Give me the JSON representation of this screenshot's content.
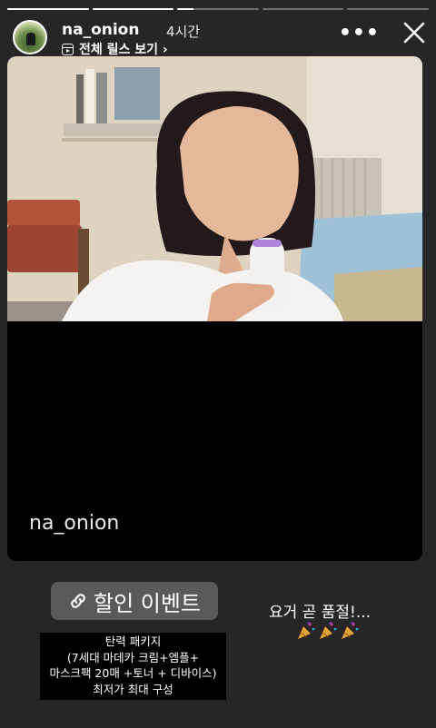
{
  "story": {
    "progress": [
      1,
      1,
      0.2,
      0,
      0
    ],
    "username": "na_onion",
    "time_ago": "4시간",
    "reels_link": "전체 릴스 보기 ›",
    "more_icon": "more-dots-icon",
    "close_icon": "close-icon"
  },
  "post": {
    "caption": "na_onion"
  },
  "stickers": {
    "link_label": "할인 이벤트",
    "link_icon": "link-icon",
    "note_lines": [
      "탄력 패키지",
      "(7세대 마데카 크림+엠플+",
      "마스크팩 20매 +토너 + 디바이스)",
      "최저가 최대 구성"
    ],
    "side_text": "요거 곧 품절!...",
    "emoji_icon": "party-popper-icon"
  },
  "colors": {
    "background": "#262626",
    "sticker_bg": "#5a5a5a"
  }
}
